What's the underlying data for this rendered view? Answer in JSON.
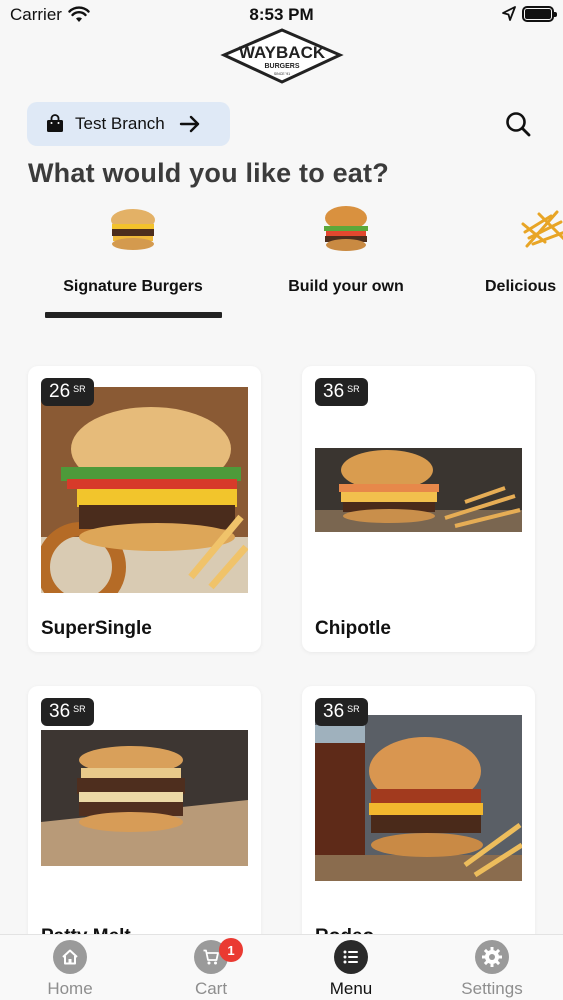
{
  "status_bar": {
    "carrier": "Carrier",
    "time": "8:53 PM"
  },
  "brand": {
    "logo_title": "WAYBACK",
    "logo_subtitle": "BURGERS",
    "logo_since": "SINCE '91"
  },
  "branch": {
    "label": "Test Branch",
    "icon": "shopping-bag-icon",
    "arrow_icon": "arrow-right-icon"
  },
  "search": {
    "icon": "search-icon"
  },
  "headline": "What would you like to eat?",
  "categories": [
    {
      "label": "Signature Burgers",
      "selected": true
    },
    {
      "label": "Build your own",
      "selected": false
    },
    {
      "label": "Delicious",
      "selected": false
    }
  ],
  "products": [
    {
      "name": "SuperSingle",
      "price": "26",
      "currency": "SR"
    },
    {
      "name": "Chipotle",
      "price": "36",
      "currency": "SR"
    },
    {
      "name": "Patty Melt",
      "price": "36",
      "currency": "SR"
    },
    {
      "name": "Rodeo",
      "price": "36",
      "currency": "SR"
    }
  ],
  "bottom_nav": [
    {
      "label": "Home",
      "icon": "home-icon",
      "active": false
    },
    {
      "label": "Cart",
      "icon": "cart-icon",
      "active": false,
      "badge": "1"
    },
    {
      "label": "Menu",
      "icon": "menu-list-icon",
      "active": true
    },
    {
      "label": "Settings",
      "icon": "gear-icon",
      "active": false
    }
  ],
  "colors": {
    "accent_dark": "#222222",
    "pill_bg": "#dfe9f6",
    "badge_red": "#ea3a32",
    "page_bg": "#f7f7f7"
  }
}
